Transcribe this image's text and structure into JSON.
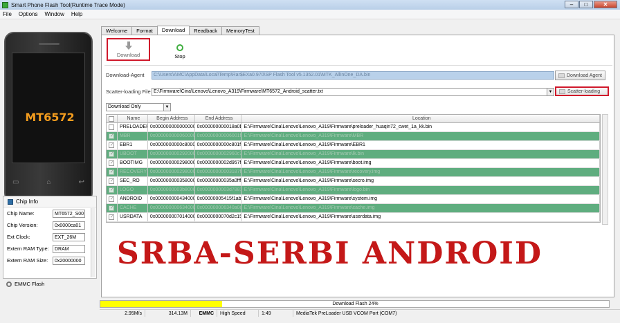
{
  "window": {
    "title": "Smart Phone Flash Tool(Runtime Trace Mode)",
    "minimize": "–",
    "maximize": "□",
    "close": "✕"
  },
  "menu": [
    "File",
    "Options",
    "Window",
    "Help"
  ],
  "device": {
    "logo": "MT6572"
  },
  "chip_info": {
    "title": "Chip Info",
    "rows": [
      {
        "label": "Chip Name:",
        "value": "MT6572_S00"
      },
      {
        "label": "Chip Version:",
        "value": "0x0000ca01"
      },
      {
        "label": "Ext Clock:",
        "value": "EXT_26M"
      },
      {
        "label": "Extern RAM Type:",
        "value": "DRAM"
      },
      {
        "label": "Extern RAM Size:",
        "value": "0x20000000"
      }
    ]
  },
  "emmc_flash": "EMMC Flash",
  "tabs": [
    "Welcome",
    "Format",
    "Download",
    "Readback",
    "MemoryTest"
  ],
  "active_tab": "Download",
  "toolbar": {
    "download": "Download",
    "stop": "Stop"
  },
  "download_agent": {
    "label": "Download-Agent",
    "value": "C:\\Users\\AMC\\AppData\\Local\\Temp\\Rar$EXa0.970\\SP Flash Tool v5.1352.01\\MTK_AllInOne_DA.bin",
    "button": "Download Agent"
  },
  "scatter": {
    "label": "Scatter-loading File",
    "value": "E:\\Firmware\\Cina\\Lenovo\\Lenovo_A319\\Firmware\\MT6572_Android_scatter.txt",
    "button": "Scatter-loading"
  },
  "mode": "Download Only",
  "table": {
    "headers": [
      "Name",
      "Begin Address",
      "End Address",
      "Location"
    ],
    "rows": [
      {
        "checked": false,
        "highlight": false,
        "name": "PRELOADER",
        "begin": "0x0000000000000000",
        "end": "0x000000000018a0b",
        "location": "E:\\Firmware\\Cina\\Lenovo\\Lenovo_A319\\Firmware\\preloader_huaqin72_cwet_1a_kk.bin"
      },
      {
        "checked": true,
        "highlight": true,
        "name": "MBR",
        "begin": "0x0000000000600000",
        "end": "0x00000000006001ff",
        "location": "E:\\Firmware\\Cina\\Lenovo\\Lenovo_A319\\Firmware\\MBR"
      },
      {
        "checked": true,
        "highlight": false,
        "name": "EBR1",
        "begin": "0x0000000000c80000",
        "end": "0x0000000000c801ff",
        "location": "E:\\Firmware\\Cina\\Lenovo\\Lenovo_A319\\Firmware\\EBR1"
      },
      {
        "checked": true,
        "highlight": true,
        "name": "UBOOT",
        "begin": "0x0000000002920000",
        "end": "0x0000000002960c73",
        "location": "E:\\Firmware\\Cina\\Lenovo\\Lenovo_A319\\Firmware\\lk.bin"
      },
      {
        "checked": true,
        "highlight": false,
        "name": "BOOTIMG",
        "begin": "0x0000000002980000",
        "end": "0x0000000002d957ff",
        "location": "E:\\Firmware\\Cina\\Lenovo\\Lenovo_A319\\Firmware\\boot.img"
      },
      {
        "checked": true,
        "highlight": true,
        "name": "RECOVERY",
        "begin": "0x0000000002980000",
        "end": "0x00000000003187ff",
        "location": "E:\\Firmware\\Cina\\Lenovo\\Lenovo_A319\\Firmware\\recovery.img"
      },
      {
        "checked": true,
        "highlight": false,
        "name": "SEC_RO",
        "begin": "0x0000000003580000",
        "end": "0x00000000035a0fff",
        "location": "E:\\Firmware\\Cina\\Lenovo\\Lenovo_A319\\Firmware\\secro.img"
      },
      {
        "checked": true,
        "highlight": true,
        "name": "LOGO",
        "begin": "0x0000000003b80000",
        "end": "0x0000000003d7881f",
        "location": "E:\\Firmware\\Cina\\Lenovo\\Lenovo_A319\\Firmware\\logo.bin"
      },
      {
        "checked": true,
        "highlight": false,
        "name": "ANDROID",
        "begin": "0x0000000004340000",
        "end": "0x00000005415f1ab",
        "location": "E:\\Firmware\\Cina\\Lenovo\\Lenovo_A319\\Firmware\\system.img"
      },
      {
        "checked": true,
        "highlight": true,
        "name": "CACHE",
        "begin": "0x0000000006340000",
        "end": "0x000000006340a0cb",
        "location": "E:\\Firmware\\Cina\\Lenovo\\Lenovo_A319\\Firmware\\cache.img"
      },
      {
        "checked": true,
        "highlight": false,
        "name": "USRDATA",
        "begin": "0x0000000070140000",
        "end": "0x0000000070d2c153",
        "location": "E:\\Firmware\\Cina\\Lenovo\\Lenovo_A319\\Firmware\\userdata.img"
      }
    ]
  },
  "watermark": "SRBA-SERBI ANDROID",
  "progress": {
    "label": "Download Flash 24%",
    "fraction": 0.24
  },
  "statusbar": [
    "2.95M/s",
    "314.13M",
    "EMMC",
    "High Speed",
    "1:49",
    "MediaTek PreLoader USB VCOM Port (COM7)"
  ]
}
